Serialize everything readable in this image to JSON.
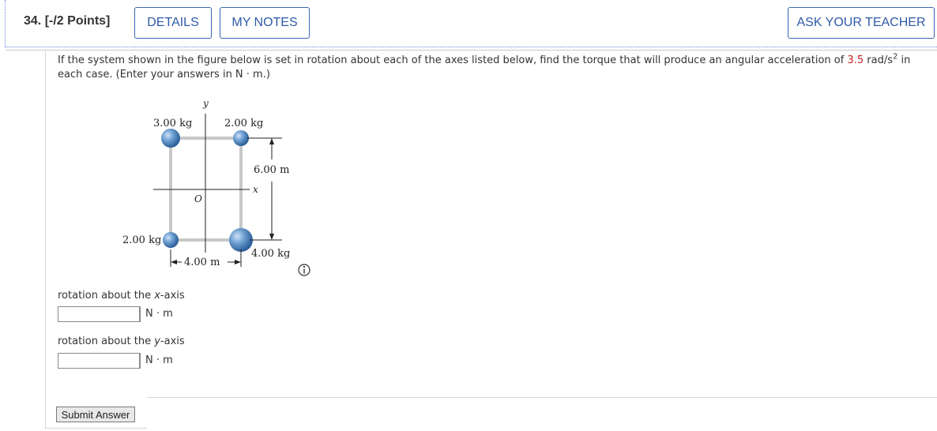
{
  "header": {
    "question_number": "34.",
    "points": "[-/2 Points]",
    "details_label": "DETAILS",
    "my_notes_label": "MY NOTES",
    "ask_teacher_label": "ASK YOUR TEACHER"
  },
  "question": {
    "prompt_before": "If the system shown in the figure below is set in rotation about each of the axes listed below, find the torque that will produce an angular acceleration of ",
    "acceleration_value": "3.5",
    "acceleration_unit": " rad/s",
    "unit_exponent": "2",
    "prompt_after": " in each case. (Enter your answers in N · m.)",
    "accent_color": "#cc2222"
  },
  "figure": {
    "mass_top_left": "3.00 kg",
    "mass_top_right": "2.00 kg",
    "mass_bottom_left": "2.00 kg",
    "mass_bottom_right": "4.00 kg",
    "height_label": "6.00 m",
    "width_label": "4.00 m",
    "axis_y": "y",
    "axis_x": "x",
    "origin": "O",
    "info_icon": "info-circle-icon"
  },
  "parts": [
    {
      "label_prefix": "rotation about the ",
      "axis": "x",
      "label_suffix": "-axis",
      "value": "",
      "unit": "N · m"
    },
    {
      "label_prefix": "rotation about the ",
      "axis": "y",
      "label_suffix": "-axis",
      "value": "",
      "unit": "N · m"
    }
  ],
  "submit_label": "Submit Answer"
}
